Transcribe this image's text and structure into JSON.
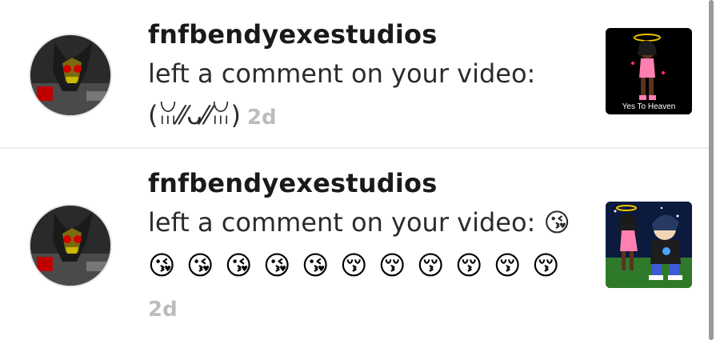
{
  "notifications": [
    {
      "username": "fnfbendyexestudios",
      "message": "left a comment on your video: (ꈍ⁄⁄ᴗ⁄⁄ꈍ)",
      "time": "2d",
      "thumbnail_caption": "Yes To Heaven"
    },
    {
      "username": "fnfbendyexestudios",
      "message": "left a comment on your video: 😘",
      "emojis": [
        "😘",
        "😘",
        "😘",
        "😘",
        "😘",
        "😚",
        "😚",
        "😚",
        "😚",
        "😚",
        "😚"
      ],
      "time": "2d"
    }
  ],
  "colors": {
    "username": "#1a1a1a",
    "message": "#2b2b2b",
    "time": "#bcbcbc",
    "divider": "#ededed"
  }
}
